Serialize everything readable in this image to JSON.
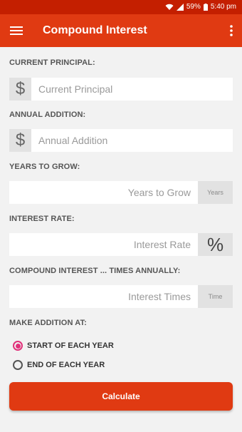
{
  "status_bar": {
    "battery": "59%",
    "time": "5:40 pm"
  },
  "app_bar": {
    "title": "Compound Interest"
  },
  "form": {
    "principal": {
      "label": "CURRENT PRINCIPAL:",
      "prefix": "$",
      "placeholder": "Current Principal",
      "value": ""
    },
    "addition": {
      "label": "ANNUAL ADDITION:",
      "prefix": "$",
      "placeholder": "Annual Addition",
      "value": ""
    },
    "years": {
      "label": "YEARS TO GROW:",
      "placeholder": "Years to Grow",
      "suffix": "Years",
      "value": ""
    },
    "rate": {
      "label": "INTEREST RATE:",
      "placeholder": "Interest Rate",
      "suffix": "%",
      "value": ""
    },
    "times": {
      "label": "COMPOUND INTEREST ... TIMES ANNUALLY:",
      "placeholder": "Interest Times",
      "suffix": "Time",
      "value": ""
    },
    "addition_timing": {
      "label": "MAKE ADDITION AT:",
      "options": [
        {
          "label": "START OF EACH YEAR",
          "selected": true
        },
        {
          "label": "END OF EACH YEAR",
          "selected": false
        }
      ]
    },
    "calculate_label": "Calculate"
  },
  "colors": {
    "primary": "#e03a12",
    "status_bar": "#c41f00",
    "radio_accent": "#e0317a"
  }
}
